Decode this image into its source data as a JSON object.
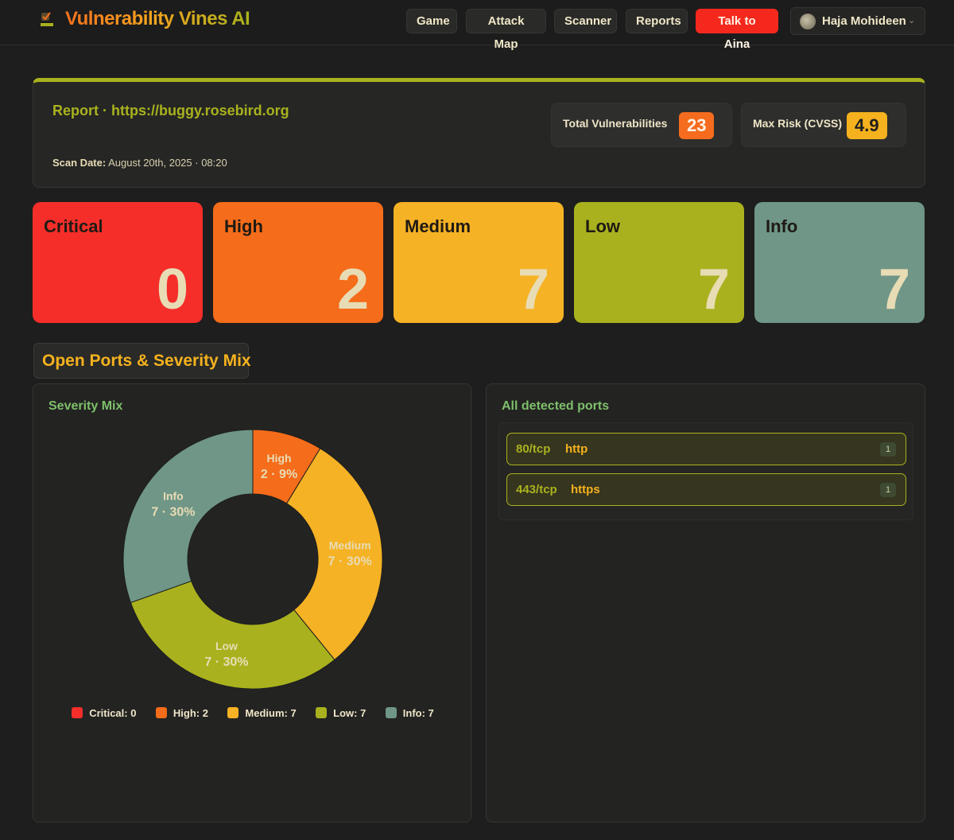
{
  "nav": {
    "brand": "Vulnerability Vines AI",
    "logo_icon": "vines-logo-icon",
    "items": [
      {
        "label": "Game"
      },
      {
        "label": "Attack Map"
      },
      {
        "label": "Scanner"
      },
      {
        "label": "Reports"
      },
      {
        "label": "Talk to Aina"
      }
    ],
    "user": {
      "name": "Haja Mohideen",
      "avatar_icon": "avatar-icon",
      "chevron_icon": "chevron-down-icon"
    }
  },
  "report": {
    "title": "Report · https://buggy.rosebird.org",
    "scan_date_label": "Scan Date:",
    "scan_date_value": "August 20th, 2025 · 08:20",
    "total_label": "Total Vulnerabilities",
    "total_value": "23",
    "max_risk_label": "Max Risk (CVSS)",
    "max_risk_value": "4.9"
  },
  "severity_cards": [
    {
      "name": "Critical",
      "count": "0",
      "color": "#f52e2a"
    },
    {
      "name": "High",
      "count": "2",
      "color": "#f56c1a"
    },
    {
      "name": "Medium",
      "count": "7",
      "color": "#f5b224"
    },
    {
      "name": "Low",
      "count": "7",
      "color": "#a9b21e"
    },
    {
      "name": "Info",
      "count": "7",
      "color": "#6f9686"
    }
  ],
  "section_title": "Open Ports & Severity Mix",
  "severity_panel": {
    "title": "Severity Mix",
    "legend": [
      {
        "label": "Critical: 0",
        "color": "#f52e2a"
      },
      {
        "label": "High: 2",
        "color": "#f56c1a"
      },
      {
        "label": "Medium: 7",
        "color": "#f5b224"
      },
      {
        "label": "Low: 7",
        "color": "#a9b21e"
      },
      {
        "label": "Info: 7",
        "color": "#6f9686"
      }
    ]
  },
  "chart_data": {
    "type": "pie",
    "variant": "donut",
    "categories": [
      "Critical",
      "High",
      "Medium",
      "Low",
      "Info"
    ],
    "values": [
      0,
      2,
      7,
      7,
      7
    ],
    "slice_labels": [
      {
        "name": "High",
        "detail": "2 · 9%"
      },
      {
        "name": "Medium",
        "detail": "7 · 30%"
      },
      {
        "name": "Low",
        "detail": "7 · 30%"
      },
      {
        "name": "Info",
        "detail": "7 · 30%"
      }
    ],
    "colors": [
      "#f52e2a",
      "#f56c1a",
      "#f5b224",
      "#a9b21e",
      "#6f9686"
    ],
    "legend_position": "bottom"
  },
  "ports_panel": {
    "title": "All detected ports",
    "ports": [
      {
        "port": "80/tcp",
        "service": "http",
        "count": "1"
      },
      {
        "port": "443/tcp",
        "service": "https",
        "count": "1"
      }
    ]
  }
}
